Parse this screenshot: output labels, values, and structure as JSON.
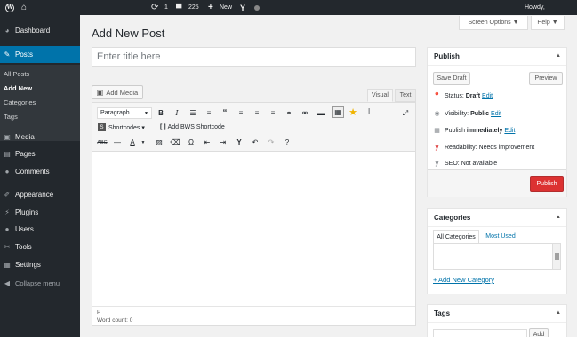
{
  "adminbar": {
    "comments_bubble": "1",
    "comments_count": "225",
    "new_label": "New",
    "howdy": "Howdy,"
  },
  "header": {
    "screen_options": "Screen Options ▼",
    "help": "Help ▼",
    "page_title": "Add New Post"
  },
  "sidebar": {
    "items": [
      {
        "label": "Dashboard",
        "icon": "dashboard-icon",
        "glyph": "◕"
      },
      {
        "label": "Posts",
        "icon": "pin-icon",
        "glyph": "✎"
      },
      {
        "label": "Media",
        "icon": "media-icon",
        "glyph": "▣"
      },
      {
        "label": "Pages",
        "icon": "pages-icon",
        "glyph": "▤"
      },
      {
        "label": "Comments",
        "icon": "comment-icon",
        "glyph": "●"
      },
      {
        "label": "Appearance",
        "icon": "brush-icon",
        "glyph": "✐"
      },
      {
        "label": "Plugins",
        "icon": "plugin-icon",
        "glyph": "⚡"
      },
      {
        "label": "Users",
        "icon": "user-icon",
        "glyph": "●"
      },
      {
        "label": "Tools",
        "icon": "wrench-icon",
        "glyph": "✂"
      },
      {
        "label": "Settings",
        "icon": "settings-icon",
        "glyph": "▦"
      },
      {
        "label": "Collapse menu",
        "icon": "collapse-icon",
        "glyph": "◀"
      }
    ],
    "submenu": [
      "All Posts",
      "Add New",
      "Categories",
      "Tags"
    ]
  },
  "title_input": {
    "placeholder": "Enter title here"
  },
  "editor": {
    "add_media": "Add Media",
    "tab_visual": "Visual",
    "tab_text": "Text",
    "format_select": "Paragraph",
    "shortcodes": "Shortcodes ▾",
    "bws_shortcode": "Add BWS Shortcode",
    "path": "P",
    "word_count": "Word count: 0"
  },
  "publish": {
    "title": "Publish",
    "save_draft": "Save Draft",
    "preview": "Preview",
    "status_label": "Status:",
    "status_value": "Draft",
    "edit": "Edit",
    "visibility_label": "Visibility:",
    "visibility_value": "Public",
    "publish_label": "Publish",
    "publish_value": "immediately",
    "readability_label": "Readability:",
    "readability_value": "Needs improvement",
    "seo_label": "SEO:",
    "seo_value": "Not available",
    "publish_button": "Publish"
  },
  "categories": {
    "title": "Categories",
    "tab_all": "All Categories",
    "tab_most": "Most Used",
    "add_new": "+ Add New Category"
  },
  "tags": {
    "title": "Tags",
    "add": "Add"
  },
  "colors": {
    "adminbar_bg": "#23282d",
    "accent": "#0073aa",
    "publish_red": "#dc3232"
  }
}
